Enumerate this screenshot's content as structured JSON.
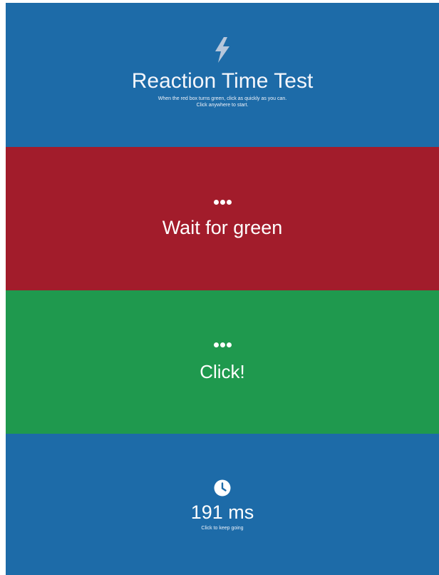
{
  "colors": {
    "intro_bg": "#1d6ba8",
    "wait_bg": "#a21c2b",
    "go_bg": "#1f994e",
    "result_bg": "#1d6ba8"
  },
  "intro": {
    "icon": "lightning-bolt-icon",
    "title": "Reaction Time Test",
    "subtitle_line1": "When the red box turns green, click as quickly as you can.",
    "subtitle_line2": "Click anywhere to start."
  },
  "wait": {
    "icon": "ellipsis-icon",
    "label": "Wait for green"
  },
  "go": {
    "icon": "ellipsis-icon",
    "label": "Click!"
  },
  "result": {
    "icon": "clock-icon",
    "time": "191 ms",
    "hint": "Click to keep going"
  }
}
